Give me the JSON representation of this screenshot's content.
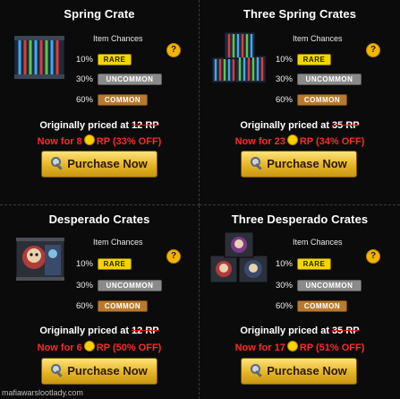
{
  "chances_head": "Item Chances",
  "help_glyph": "?",
  "orig_prefix": "Originally priced at",
  "rp": "RP",
  "buy_label": "Purchase Now",
  "cards": [
    {
      "title": "Spring Crate",
      "crate_icon": "spring-crate-icon",
      "chances": [
        {
          "pct": "10%",
          "label": "RARE"
        },
        {
          "pct": "30%",
          "label": "UNCOMMON"
        },
        {
          "pct": "60%",
          "label": "COMMON"
        }
      ],
      "orig_price": "12",
      "now_prefix": "Now for",
      "now_price": "8",
      "off": "(33% OFF)"
    },
    {
      "title": "Three Spring Crates",
      "crate_icon": "three-spring-crates-icon",
      "chances": [
        {
          "pct": "10%",
          "label": "RARE"
        },
        {
          "pct": "30%",
          "label": "UNCOMMON"
        },
        {
          "pct": "60%",
          "label": "COMMON"
        }
      ],
      "orig_price": "35",
      "now_prefix": "Now for",
      "now_price": "23",
      "off": "(34% OFF)"
    },
    {
      "title": "Desperado Crates",
      "crate_icon": "desperado-crate-icon",
      "chances": [
        {
          "pct": "10%",
          "label": "RARE"
        },
        {
          "pct": "30%",
          "label": "UNCOMMON"
        },
        {
          "pct": "60%",
          "label": "COMMON"
        }
      ],
      "orig_price": "12",
      "now_prefix": "Now for",
      "now_price": "6",
      "off": "(50% OFF)"
    },
    {
      "title": "Three Desperado Crates",
      "crate_icon": "three-desperado-crates-icon",
      "chances": [
        {
          "pct": "10%",
          "label": "RARE"
        },
        {
          "pct": "30%",
          "label": "UNCOMMON"
        },
        {
          "pct": "60%",
          "label": "COMMON"
        }
      ],
      "orig_price": "35",
      "now_prefix": "Now for",
      "now_price": "17",
      "off": "(51% OFF)"
    }
  ],
  "footer": "mafiawarslootlady.com",
  "colors": {
    "rare": "#f4d500",
    "uncommon": "#8a8a8a",
    "common": "#b77a2e",
    "sale": "#ff2a2a",
    "button": "#e5b526"
  }
}
